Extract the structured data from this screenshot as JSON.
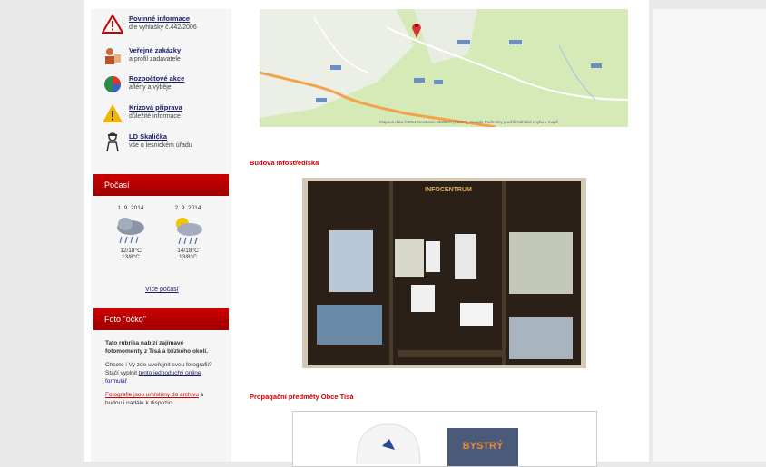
{
  "sidebar": {
    "links": [
      {
        "title": "Povinné informace",
        "subtitle": "dle vyhlášky č.442/2006",
        "icon": "warning-triangle-icon"
      },
      {
        "title": "Veřejné zakázky",
        "subtitle": "a profil zadavatele",
        "icon": "tender-icon"
      },
      {
        "title": "Rozpočtové akce",
        "subtitle": "aflény a výběje",
        "icon": "budget-chart-icon"
      },
      {
        "title": "Krizová připrava",
        "subtitle": "důležité informace",
        "icon": "crisis-warning-icon"
      },
      {
        "title": "LD Skalička",
        "subtitle": "vše o lesnickém úřadu",
        "icon": "forest-ranger-icon"
      }
    ],
    "weather": {
      "heading": "Počasí",
      "days": [
        {
          "date": "1. 9. 2014",
          "temp_day": "12/18°C",
          "temp_night": "13/8°C",
          "icon": "rain-cloud-icon"
        },
        {
          "date": "2. 9. 2014",
          "temp_day": "14/18°C",
          "temp_night": "13/8°C",
          "icon": "sun-rain-cloud-icon"
        }
      ],
      "more_link": "Více počasí"
    },
    "photo_box": {
      "heading": "Foto \"očko\"",
      "intro": "Tato rubrika nabízí zajímavé fotomomenty z Tisá a blízkého okolí.",
      "text_before_link": "Chcete i Vy zde uveřejnit svou fotografii? Stačí vyplnit",
      "link": "tento jednoduchý online formulář",
      "red_link": "Fotografie jsou umístěny do archivu",
      "text_after_red": "a budou i nadále k dispozici."
    }
  },
  "main": {
    "map_attribution": "Mapová data ©2014 GeoBasis-DE/BKG (©2009), Google   Podmínky použití   Nahlásit chybu v mapě",
    "sections": [
      {
        "title": "Budova Infostřediska"
      },
      {
        "title": "Propagační předměty Obce Tisá"
      }
    ],
    "photo_sign": "INFOCENTRUM",
    "promo_label": "BYSTRÝ"
  },
  "colors": {
    "accent": "#c00000",
    "link": "#1a1a6a",
    "map_green": "#d3e8b5",
    "road": "#f4a24a"
  }
}
